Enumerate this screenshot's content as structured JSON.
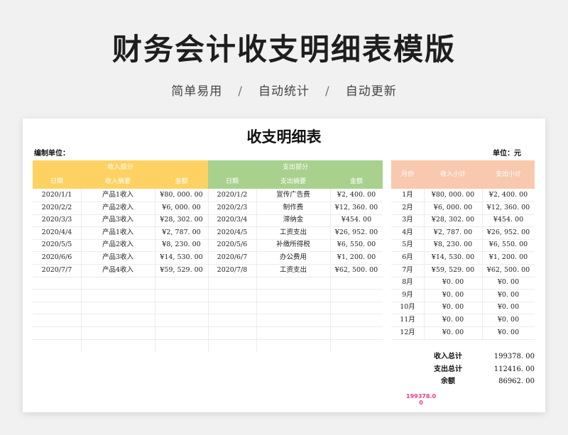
{
  "page": {
    "title": "财务会计收支明细表模版",
    "tags": [
      "简单易用",
      "自动统计",
      "自动更新"
    ],
    "separator": "/"
  },
  "sheet": {
    "title": "收支明细表",
    "compiler_label": "编制单位：",
    "unit_label": "单位：元",
    "income_header": {
      "group": "收入部分",
      "date": "日期",
      "summary": "收入摘要",
      "amount": "金额"
    },
    "expense_header": {
      "group": "支出部分",
      "date": "日期",
      "summary": "支出摘要",
      "amount": "金额"
    },
    "monthly_header": {
      "month": "月份",
      "income": "收入小计",
      "expense": "支出小计"
    },
    "income_rows": [
      {
        "date": "2020/1/1",
        "summary": "产品1收入",
        "amount": "¥80, 000. 00"
      },
      {
        "date": "2020/2/2",
        "summary": "产品2收入",
        "amount": "¥6, 000. 00"
      },
      {
        "date": "2020/3/3",
        "summary": "产品3收入",
        "amount": "¥28, 302. 00"
      },
      {
        "date": "2020/4/4",
        "summary": "产品1收入",
        "amount": "¥2, 787. 00"
      },
      {
        "date": "2020/5/5",
        "summary": "产品2收入",
        "amount": "¥8, 230. 00"
      },
      {
        "date": "2020/6/6",
        "summary": "产品3收入",
        "amount": "¥14, 530. 00"
      },
      {
        "date": "2020/7/7",
        "summary": "产品4收入",
        "amount": "¥59, 529. 00"
      }
    ],
    "expense_rows": [
      {
        "date": "2020/1/2",
        "summary": "宣传广告费",
        "amount": "¥2, 400. 00"
      },
      {
        "date": "2020/2/3",
        "summary": "制作费",
        "amount": "¥12, 360. 00"
      },
      {
        "date": "2020/3/4",
        "summary": "滞纳金",
        "amount": "¥454. 00"
      },
      {
        "date": "2020/4/5",
        "summary": "工资支出",
        "amount": "¥26, 952. 00"
      },
      {
        "date": "2020/5/6",
        "summary": "补缴所得税",
        "amount": "¥6, 550. 00"
      },
      {
        "date": "2020/6/7",
        "summary": "办公费用",
        "amount": "¥1, 200. 00"
      },
      {
        "date": "2020/7/8",
        "summary": "工资支出",
        "amount": "¥62, 500. 00"
      }
    ],
    "monthly_rows": [
      {
        "month": "1月",
        "income": "¥80, 000. 00",
        "expense": "¥2, 400. 00"
      },
      {
        "month": "2月",
        "income": "¥6, 000. 00",
        "expense": "¥12, 360. 00"
      },
      {
        "month": "3月",
        "income": "¥28, 302. 00",
        "expense": "¥454. 00"
      },
      {
        "month": "4月",
        "income": "¥2, 787. 00",
        "expense": "¥26, 952. 00"
      },
      {
        "month": "5月",
        "income": "¥8, 230. 00",
        "expense": "¥6, 550. 00"
      },
      {
        "month": "6月",
        "income": "¥14, 530. 00",
        "expense": "¥1, 200. 00"
      },
      {
        "month": "7月",
        "income": "¥59, 529. 00",
        "expense": "¥62, 500. 00"
      },
      {
        "month": "8月",
        "income": "¥0. 00",
        "expense": "¥0. 00"
      },
      {
        "month": "9月",
        "income": "¥0. 00",
        "expense": "¥0. 00"
      },
      {
        "month": "10月",
        "income": "¥0. 00",
        "expense": "¥0. 00"
      },
      {
        "month": "11月",
        "income": "¥0. 00",
        "expense": "¥0. 00"
      },
      {
        "month": "12月",
        "income": "¥0. 00",
        "expense": "¥0. 00"
      }
    ],
    "totals": [
      {
        "label": "收入总计",
        "value": "199378. 00"
      },
      {
        "label": "支出总计",
        "value": "112416. 00"
      },
      {
        "label": "余额",
        "value": "86962. 00"
      }
    ],
    "note": "199378.00"
  },
  "colors": {
    "income_header": "#fdd262",
    "expense_header": "#a8d18d",
    "monthly_header": "#f8c9ae",
    "note_text": "#e0408a"
  }
}
